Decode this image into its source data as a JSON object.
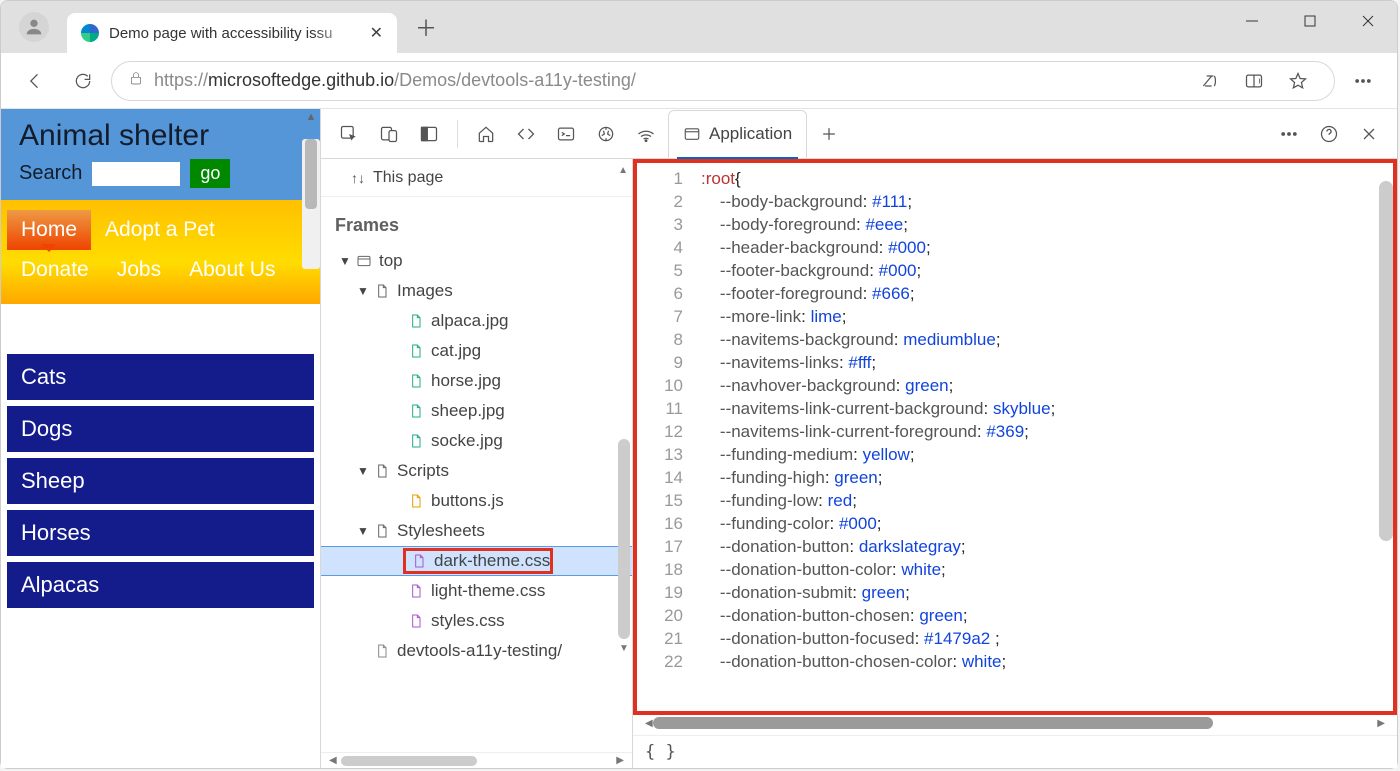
{
  "browser": {
    "tab_title": "Demo page with accessibility issu",
    "url_prefix": "https://",
    "url_host": "microsoftedge.github.io",
    "url_path": "/Demos/devtools-a11y-testing/"
  },
  "page": {
    "title": "Animal shelter",
    "search_label": "Search",
    "go_label": "go",
    "nav": [
      "Home",
      "Adopt a Pet",
      "Donate",
      "Jobs",
      "About Us"
    ],
    "sidenav": [
      "Cats",
      "Dogs",
      "Sheep",
      "Horses",
      "Alpacas"
    ]
  },
  "devtools": {
    "active_tab": "Application",
    "this_page_label": "This page",
    "section_label": "Frames",
    "tree": {
      "top_label": "top",
      "images_label": "Images",
      "images": [
        "alpaca.jpg",
        "cat.jpg",
        "horse.jpg",
        "sheep.jpg",
        "socke.jpg"
      ],
      "scripts_label": "Scripts",
      "scripts": [
        "buttons.js"
      ],
      "stylesheets_label": "Stylesheets",
      "stylesheets": [
        "dark-theme.css",
        "light-theme.css",
        "styles.css"
      ],
      "selected": "dark-theme.css",
      "doc": "devtools-a11y-testing/"
    },
    "footer": "{ }"
  },
  "code": {
    "lines": [
      {
        "raw": ":root{",
        "t": "sel"
      },
      {
        "p": "--body-background",
        "v": "#111"
      },
      {
        "p": "--body-foreground",
        "v": "#eee"
      },
      {
        "p": "--header-background",
        "v": "#000"
      },
      {
        "p": "--footer-background",
        "v": "#000"
      },
      {
        "p": "--footer-foreground",
        "v": "#666"
      },
      {
        "p": "--more-link",
        "v": "lime"
      },
      {
        "p": "--navitems-background",
        "v": "mediumblue"
      },
      {
        "p": "--navitems-links",
        "v": "#fff"
      },
      {
        "p": "--navhover-background",
        "v": "green"
      },
      {
        "p": "--navitems-link-current-background",
        "v": "skyblue"
      },
      {
        "p": "--navitems-link-current-foreground",
        "v": "#369"
      },
      {
        "p": "--funding-medium",
        "v": "yellow"
      },
      {
        "p": "--funding-high",
        "v": "green"
      },
      {
        "p": "--funding-low",
        "v": "red"
      },
      {
        "p": "--funding-color",
        "v": "#000"
      },
      {
        "p": "--donation-button",
        "v": "darkslategray"
      },
      {
        "p": "--donation-button-color",
        "v": "white"
      },
      {
        "p": "--donation-submit",
        "v": "green"
      },
      {
        "p": "--donation-button-chosen",
        "v": "green"
      },
      {
        "p": "--donation-button-focused",
        "v": "#1479a2 "
      },
      {
        "p": "--donation-button-chosen-color",
        "v": "white"
      }
    ]
  }
}
